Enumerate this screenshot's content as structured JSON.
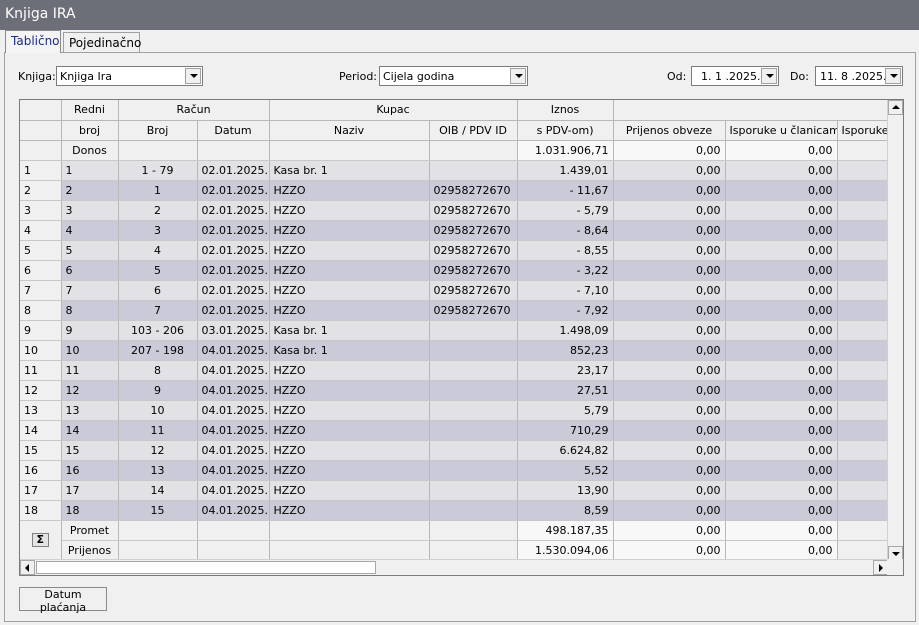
{
  "window": {
    "title": "Knjiga IRA"
  },
  "tabs": [
    {
      "label": "Tablično",
      "active": true
    },
    {
      "label": "Pojedinačno",
      "active": false
    }
  ],
  "filters": {
    "knjiga_label": "Knjiga:",
    "knjiga_value": "Knjiga Ira",
    "period_label": "Period:",
    "period_value": "Cijela godina",
    "od_label": "Od:",
    "od_value": "1. 1 .2025.",
    "do_label": "Do:",
    "do_value": "11. 8 .2025."
  },
  "grid": {
    "header_top": {
      "redni": "Redni",
      "racun": "Račun",
      "kupac": "Kupac",
      "iznos": "Iznos"
    },
    "header_bottom": {
      "broj": "broj",
      "racun_broj": "Broj",
      "datum": "Datum",
      "naziv": "Naziv",
      "oib": "OIB / PDV ID",
      "iznos_sub": "s PDV-om)",
      "prijenos_obveze": "Prijenos obveze",
      "isporuke_clanicama": "Isporuke u članicama",
      "isporuke": "Isporuke"
    },
    "donos": {
      "label": "Donos",
      "iznos": "1.031.906,71",
      "prijenos_obveze": "0,00",
      "isporuke_clanicama": "0,00"
    },
    "rows": [
      {
        "idx": "1",
        "redni": "1",
        "broj": "1 - 79",
        "datum": "02.01.2025.",
        "naziv": "Kasa br. 1",
        "oib": "",
        "iznos": "1.439,01",
        "prijenos": "0,00",
        "clanice": "0,00"
      },
      {
        "idx": "2",
        "redni": "2",
        "broj": "1",
        "datum": "02.01.2025.",
        "naziv": "HZZO",
        "oib": "02958272670",
        "iznos": "- 11,67",
        "prijenos": "0,00",
        "clanice": "0,00"
      },
      {
        "idx": "3",
        "redni": "3",
        "broj": "2",
        "datum": "02.01.2025.",
        "naziv": "HZZO",
        "oib": "02958272670",
        "iznos": "- 5,79",
        "prijenos": "0,00",
        "clanice": "0,00"
      },
      {
        "idx": "4",
        "redni": "4",
        "broj": "3",
        "datum": "02.01.2025.",
        "naziv": "HZZO",
        "oib": "02958272670",
        "iznos": "- 8,64",
        "prijenos": "0,00",
        "clanice": "0,00"
      },
      {
        "idx": "5",
        "redni": "5",
        "broj": "4",
        "datum": "02.01.2025.",
        "naziv": "HZZO",
        "oib": "02958272670",
        "iznos": "- 8,55",
        "prijenos": "0,00",
        "clanice": "0,00"
      },
      {
        "idx": "6",
        "redni": "6",
        "broj": "5",
        "datum": "02.01.2025.",
        "naziv": "HZZO",
        "oib": "02958272670",
        "iznos": "- 3,22",
        "prijenos": "0,00",
        "clanice": "0,00"
      },
      {
        "idx": "7",
        "redni": "7",
        "broj": "6",
        "datum": "02.01.2025.",
        "naziv": "HZZO",
        "oib": "02958272670",
        "iznos": "- 7,10",
        "prijenos": "0,00",
        "clanice": "0,00"
      },
      {
        "idx": "8",
        "redni": "8",
        "broj": "7",
        "datum": "02.01.2025.",
        "naziv": "HZZO",
        "oib": "02958272670",
        "iznos": "- 7,92",
        "prijenos": "0,00",
        "clanice": "0,00"
      },
      {
        "idx": "9",
        "redni": "9",
        "broj": "103 - 206",
        "datum": "03.01.2025.",
        "naziv": "Kasa br. 1",
        "oib": "",
        "iznos": "1.498,09",
        "prijenos": "0,00",
        "clanice": "0,00"
      },
      {
        "idx": "10",
        "redni": "10",
        "broj": "207 - 198",
        "datum": "04.01.2025.",
        "naziv": "Kasa br. 1",
        "oib": "",
        "iznos": "852,23",
        "prijenos": "0,00",
        "clanice": "0,00"
      },
      {
        "idx": "11",
        "redni": "11",
        "broj": "8",
        "datum": "04.01.2025.",
        "naziv": "HZZO",
        "oib": "",
        "iznos": "23,17",
        "prijenos": "0,00",
        "clanice": "0,00"
      },
      {
        "idx": "12",
        "redni": "12",
        "broj": "9",
        "datum": "04.01.2025.",
        "naziv": "HZZO",
        "oib": "",
        "iznos": "27,51",
        "prijenos": "0,00",
        "clanice": "0,00"
      },
      {
        "idx": "13",
        "redni": "13",
        "broj": "10",
        "datum": "04.01.2025.",
        "naziv": "HZZO",
        "oib": "",
        "iznos": "5,79",
        "prijenos": "0,00",
        "clanice": "0,00"
      },
      {
        "idx": "14",
        "redni": "14",
        "broj": "11",
        "datum": "04.01.2025.",
        "naziv": "HZZO",
        "oib": "",
        "iznos": "710,29",
        "prijenos": "0,00",
        "clanice": "0,00"
      },
      {
        "idx": "15",
        "redni": "15",
        "broj": "12",
        "datum": "04.01.2025.",
        "naziv": "HZZO",
        "oib": "",
        "iznos": "6.624,82",
        "prijenos": "0,00",
        "clanice": "0,00"
      },
      {
        "idx": "16",
        "redni": "16",
        "broj": "13",
        "datum": "04.01.2025.",
        "naziv": "HZZO",
        "oib": "",
        "iznos": "5,52",
        "prijenos": "0,00",
        "clanice": "0,00"
      },
      {
        "idx": "17",
        "redni": "17",
        "broj": "14",
        "datum": "04.01.2025.",
        "naziv": "HZZO",
        "oib": "",
        "iznos": "13,90",
        "prijenos": "0,00",
        "clanice": "0,00"
      },
      {
        "idx": "18",
        "redni": "18",
        "broj": "15",
        "datum": "04.01.2025.",
        "naziv": "HZZO",
        "oib": "",
        "iznos": "8,59",
        "prijenos": "0,00",
        "clanice": "0,00"
      }
    ],
    "promet": {
      "label": "Promet",
      "iznos": "498.187,35",
      "prijenos_obveze": "0,00",
      "isporuke_clanicama": "0,00"
    },
    "prijenos": {
      "label": "Prijenos",
      "iznos": "1.530.094,06",
      "prijenos_obveze": "0,00",
      "isporuke_clanicama": "0,00"
    },
    "sigma_icon": "Σ"
  },
  "buttons": {
    "datum_placanja": "Datum plaćanja"
  },
  "icons": {
    "dropdown": "chevron-down-icon",
    "scroll_up": "arrow-up-icon",
    "scroll_down": "arrow-down-icon",
    "scroll_left": "arrow-left-icon",
    "scroll_right": "arrow-right-icon",
    "sum": "sigma-icon"
  },
  "colors": {
    "titlebar": "#6d6f78",
    "row_odd": "#e2e2e6",
    "row_even": "#cacad8",
    "tab_active_text": "#1c2d8a"
  }
}
